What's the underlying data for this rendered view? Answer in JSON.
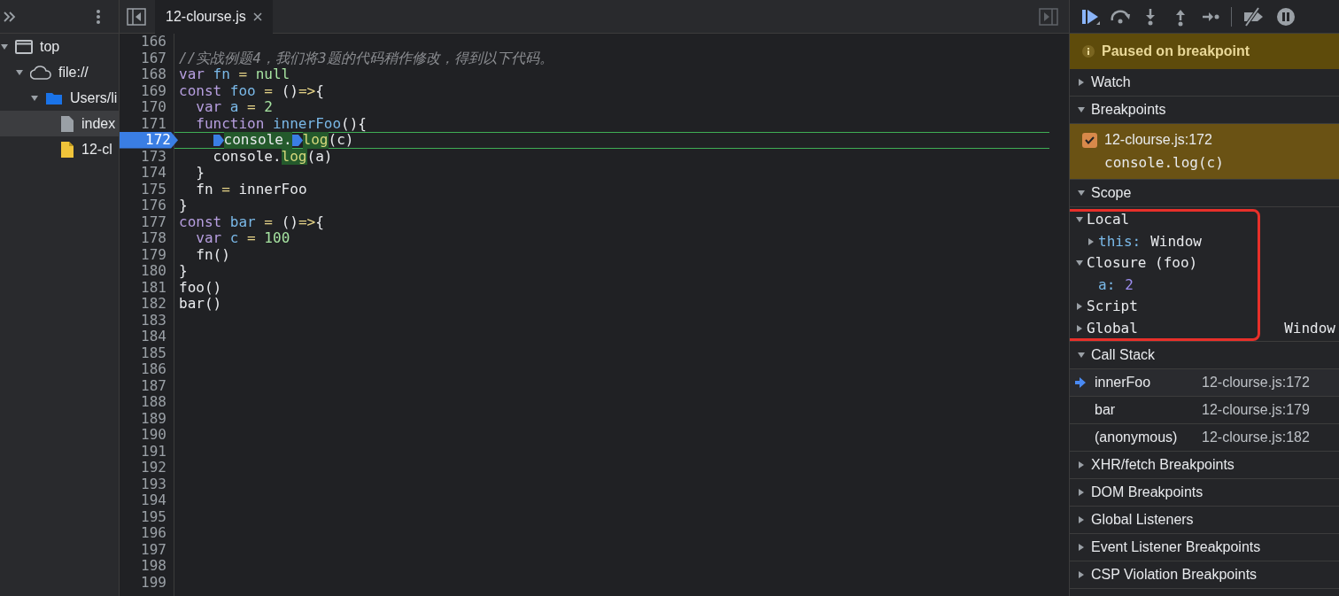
{
  "navigator": [
    {
      "label": "top",
      "kind": "frame",
      "expanded": true,
      "selected": false,
      "children": [
        {
          "label": "file://",
          "kind": "origin",
          "expanded": true,
          "selected": false,
          "children": [
            {
              "label": "Users/li",
              "kind": "folder",
              "expanded": true,
              "selected": false,
              "children": [
                {
                  "label": "index",
                  "kind": "file",
                  "selected": true
                },
                {
                  "label": "12-cl",
                  "kind": "script",
                  "selected": false
                }
              ]
            }
          ]
        }
      ]
    }
  ],
  "editor_tabs": [
    {
      "label": "12-clourse.js",
      "selected": true
    }
  ],
  "code_lines": [
    {
      "number": "166",
      "paused": false
    },
    {
      "number": "167",
      "paused": false,
      "tokens": [
        {
          "text": "//实战例题4，我们将3题的代码稍作修改，得到以下代码。",
          "kind": "comment"
        }
      ]
    },
    {
      "number": "168",
      "paused": false,
      "tokens": [
        {
          "text": "var",
          "kind": "keyword"
        },
        {
          "text": " fn",
          "kind": "name"
        },
        {
          "text": " = ",
          "kind": "operator"
        },
        {
          "text": "null",
          "kind": "literal"
        }
      ]
    },
    {
      "number": "169",
      "paused": false,
      "tokens": [
        {
          "text": "const",
          "kind": "keyword"
        },
        {
          "text": " foo",
          "kind": "name"
        },
        {
          "text": " = ",
          "kind": "operator"
        },
        {
          "text": "()",
          "kind": "plain"
        },
        {
          "text": "=>",
          "kind": "operator"
        },
        {
          "text": "{",
          "kind": "plain"
        }
      ]
    },
    {
      "number": "170",
      "paused": false,
      "tokens": [
        {
          "text": "  var",
          "kind": "keyword"
        },
        {
          "text": " a",
          "kind": "name"
        },
        {
          "text": " = ",
          "kind": "operator"
        },
        {
          "text": "2",
          "kind": "literal"
        }
      ]
    },
    {
      "number": "171",
      "paused": false,
      "tokens": [
        {
          "text": "  function",
          "kind": "keyword"
        },
        {
          "text": " innerFoo",
          "kind": "name"
        },
        {
          "text": "(){",
          "kind": "plain"
        }
      ]
    },
    {
      "number": "172",
      "paused": true,
      "tokens": [
        {
          "text": "    console.",
          "kind": "marked",
          "pause_marker": true
        },
        {
          "text": "log",
          "kind": "marked-call",
          "pause_marker": true
        },
        {
          "text": "(c)",
          "kind": "plain"
        }
      ]
    },
    {
      "number": "173",
      "paused": false,
      "tokens": [
        {
          "text": "    console.",
          "kind": "plain"
        },
        {
          "text": "log",
          "kind": "marked-call"
        },
        {
          "text": "(a)",
          "kind": "plain"
        }
      ]
    },
    {
      "number": "174",
      "paused": false,
      "tokens": [
        {
          "text": "  }",
          "kind": "plain"
        }
      ]
    },
    {
      "number": "175",
      "paused": false,
      "tokens": [
        {
          "text": "  fn ",
          "kind": "plain"
        },
        {
          "text": "=",
          "kind": "operator"
        },
        {
          "text": " innerFoo",
          "kind": "plain"
        }
      ]
    },
    {
      "number": "176",
      "paused": false,
      "tokens": [
        {
          "text": "}",
          "kind": "plain"
        }
      ]
    },
    {
      "number": "177",
      "paused": false,
      "tokens": [
        {
          "text": "const",
          "kind": "keyword"
        },
        {
          "text": " bar",
          "kind": "name"
        },
        {
          "text": " = ",
          "kind": "operator"
        },
        {
          "text": "()",
          "kind": "plain"
        },
        {
          "text": "=>",
          "kind": "operator"
        },
        {
          "text": "{",
          "kind": "plain"
        }
      ]
    },
    {
      "number": "178",
      "paused": false,
      "tokens": [
        {
          "text": "  var",
          "kind": "keyword"
        },
        {
          "text": " c",
          "kind": "name"
        },
        {
          "text": " = ",
          "kind": "operator"
        },
        {
          "text": "100",
          "kind": "literal"
        }
      ]
    },
    {
      "number": "179",
      "paused": false,
      "tokens": [
        {
          "text": "  fn()",
          "kind": "plain"
        }
      ]
    },
    {
      "number": "180",
      "paused": false,
      "tokens": [
        {
          "text": "}",
          "kind": "plain"
        }
      ]
    },
    {
      "number": "181",
      "paused": false,
      "tokens": [
        {
          "text": "foo()",
          "kind": "plain"
        }
      ]
    },
    {
      "number": "182",
      "paused": false,
      "tokens": [
        {
          "text": "bar()",
          "kind": "plain"
        }
      ]
    },
    {
      "number": "183",
      "paused": false
    },
    {
      "number": "184",
      "paused": false
    },
    {
      "number": "185",
      "paused": false
    },
    {
      "number": "186",
      "paused": false
    },
    {
      "number": "187",
      "paused": false
    },
    {
      "number": "188",
      "paused": false
    },
    {
      "number": "189",
      "paused": false
    },
    {
      "number": "190",
      "paused": false
    },
    {
      "number": "191",
      "paused": false
    },
    {
      "number": "192",
      "paused": false
    },
    {
      "number": "193",
      "paused": false
    },
    {
      "number": "194",
      "paused": false
    },
    {
      "number": "195",
      "paused": false
    },
    {
      "number": "196",
      "paused": false
    },
    {
      "number": "197",
      "paused": false
    },
    {
      "number": "198",
      "paused": false
    },
    {
      "number": "199",
      "paused": false
    }
  ],
  "paused_banner": "Paused on breakpoint",
  "sections": [
    {
      "title": "Watch",
      "expanded": false
    },
    {
      "title": "Breakpoints",
      "expanded": true,
      "breakpoints": [
        {
          "location": "12-clourse.js:172",
          "code": "console.log(c)",
          "checked": true
        }
      ]
    },
    {
      "title": "Scope",
      "expanded": true,
      "annotated": true,
      "scope": [
        {
          "name": "Local",
          "kind": "scope",
          "expanded": true,
          "children": [
            {
              "name": "this:",
              "value": "Window",
              "kind": "object-property",
              "expanded": false
            }
          ]
        },
        {
          "name": "Closure (foo)",
          "kind": "scope",
          "expanded": true,
          "children": [
            {
              "name": "a:",
              "value": "2",
              "kind": "number-property"
            }
          ]
        },
        {
          "name": "Script",
          "kind": "scope",
          "expanded": false
        },
        {
          "name": "Global",
          "kind": "scope",
          "expanded": false,
          "value": "Window"
        }
      ]
    },
    {
      "title": "Call Stack",
      "expanded": true,
      "frames": [
        {
          "function": "innerFoo",
          "location": "12-clourse.js:172",
          "selected": true
        },
        {
          "function": "bar",
          "location": "12-clourse.js:179",
          "selected": false
        },
        {
          "function": "(anonymous)",
          "location": "12-clourse.js:182",
          "selected": false
        }
      ]
    },
    {
      "title": "XHR/fetch Breakpoints",
      "expanded": false
    },
    {
      "title": "DOM Breakpoints",
      "expanded": false
    },
    {
      "title": "Global Listeners",
      "expanded": false
    },
    {
      "title": "Event Listener Breakpoints",
      "expanded": false
    },
    {
      "title": "CSP Violation Breakpoints",
      "expanded": false
    }
  ]
}
